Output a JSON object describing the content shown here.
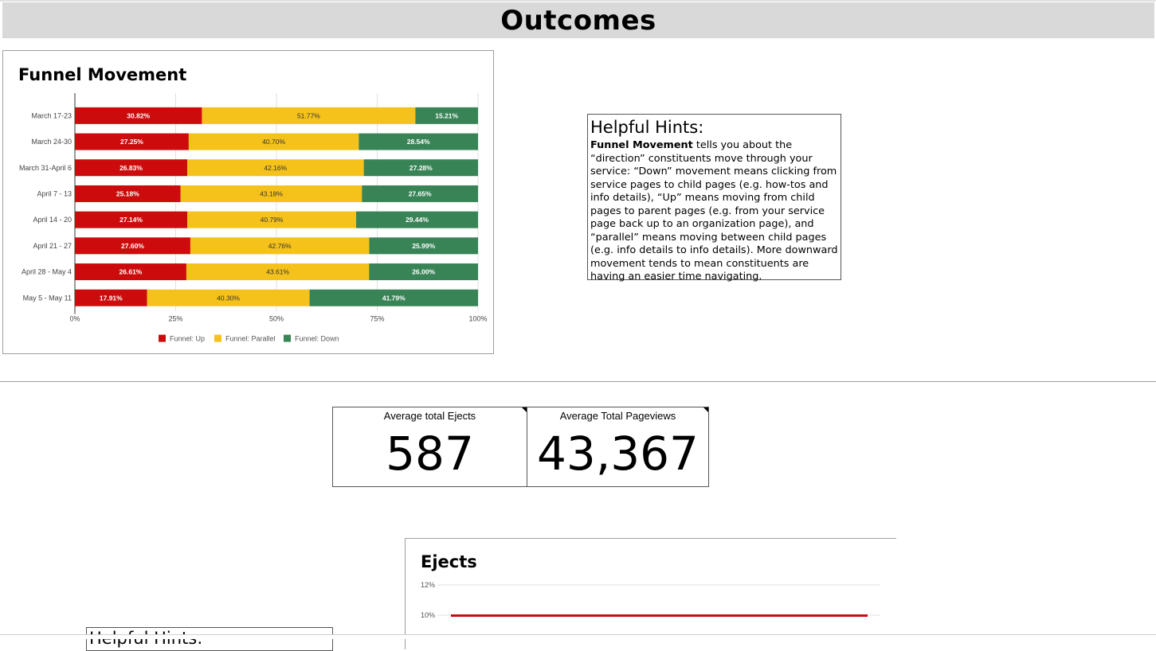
{
  "header": {
    "title": "Outcomes"
  },
  "funnel_chart": {
    "title": "Funnel Movement",
    "x_ticks": [
      "0%",
      "25%",
      "50%",
      "75%",
      "100%"
    ],
    "legend": [
      "Funnel: Up",
      "Funnel: Parallel",
      "Funnel: Down"
    ]
  },
  "chart_data": [
    {
      "type": "bar",
      "orientation": "horizontal",
      "stacked": "percent",
      "title": "Funnel Movement",
      "categories": [
        "March 17-23",
        "March 24-30",
        "March 31-April 6",
        "April 7 - 13",
        "April 14 - 20",
        "April 21 - 27",
        "April 28 - May 4",
        "May 5 - May 11"
      ],
      "series": [
        {
          "name": "Funnel: Up",
          "color": "#cc0c0c",
          "values": [
            30.82,
            27.25,
            26.83,
            25.18,
            27.14,
            27.6,
            26.61,
            17.91
          ],
          "labels": [
            "30.82%",
            "27.25%",
            "26.83%",
            "25.18%",
            "27.14%",
            "27.60%",
            "26.61%",
            "17.91%"
          ]
        },
        {
          "name": "Funnel: Parallel",
          "color": "#f5c21c",
          "values": [
            51.77,
            40.7,
            42.16,
            43.18,
            40.79,
            42.76,
            43.61,
            40.3
          ],
          "labels": [
            "51.77%",
            "40.70%",
            "42.16%",
            "43.18%",
            "40.79%",
            "42.76%",
            "43.61%",
            "40.30%"
          ]
        },
        {
          "name": "Funnel: Down",
          "color": "#398457",
          "values": [
            15.21,
            28.54,
            27.28,
            27.65,
            29.44,
            26.0,
            26.0,
            41.79
          ],
          "labels": [
            "15.21%",
            "28.54%",
            "27.28%",
            "27.65%",
            "29.44%",
            "25.99%",
            "26.00%",
            "41.79%"
          ]
        }
      ],
      "xlim": [
        0,
        100
      ],
      "legend_position": "bottom",
      "grid": true
    },
    {
      "type": "line",
      "title": "Ejects",
      "y_ticks": [
        "12%",
        "10%"
      ],
      "series": [
        {
          "color": "#cc0c0c",
          "values": [
            10,
            10
          ]
        }
      ],
      "grid": true
    }
  ],
  "hints": {
    "title": "Helpful Hints:",
    "bold_lead": "Funnel Movement",
    "body": " tells you about the “direction” constituents move through your service: “Down” movement means clicking from service pages to child pages (e.g. how-tos and info details), “Up” means moving from child pages to parent pages (e.g. from your service page back up to an organization page), and “parallel” means moving between child pages (e.g. info details to info details). More downward movement tends to mean constituents are having an easier time navigating."
  },
  "scorecards": {
    "ejects": {
      "label": "Average total Ejects",
      "value": "587"
    },
    "pageviews": {
      "label": "Average Total Pageviews",
      "value": "43,367"
    }
  },
  "ejects_chart": {
    "title": "Ejects"
  },
  "hints2": {
    "title": "Helpful Hints:"
  }
}
